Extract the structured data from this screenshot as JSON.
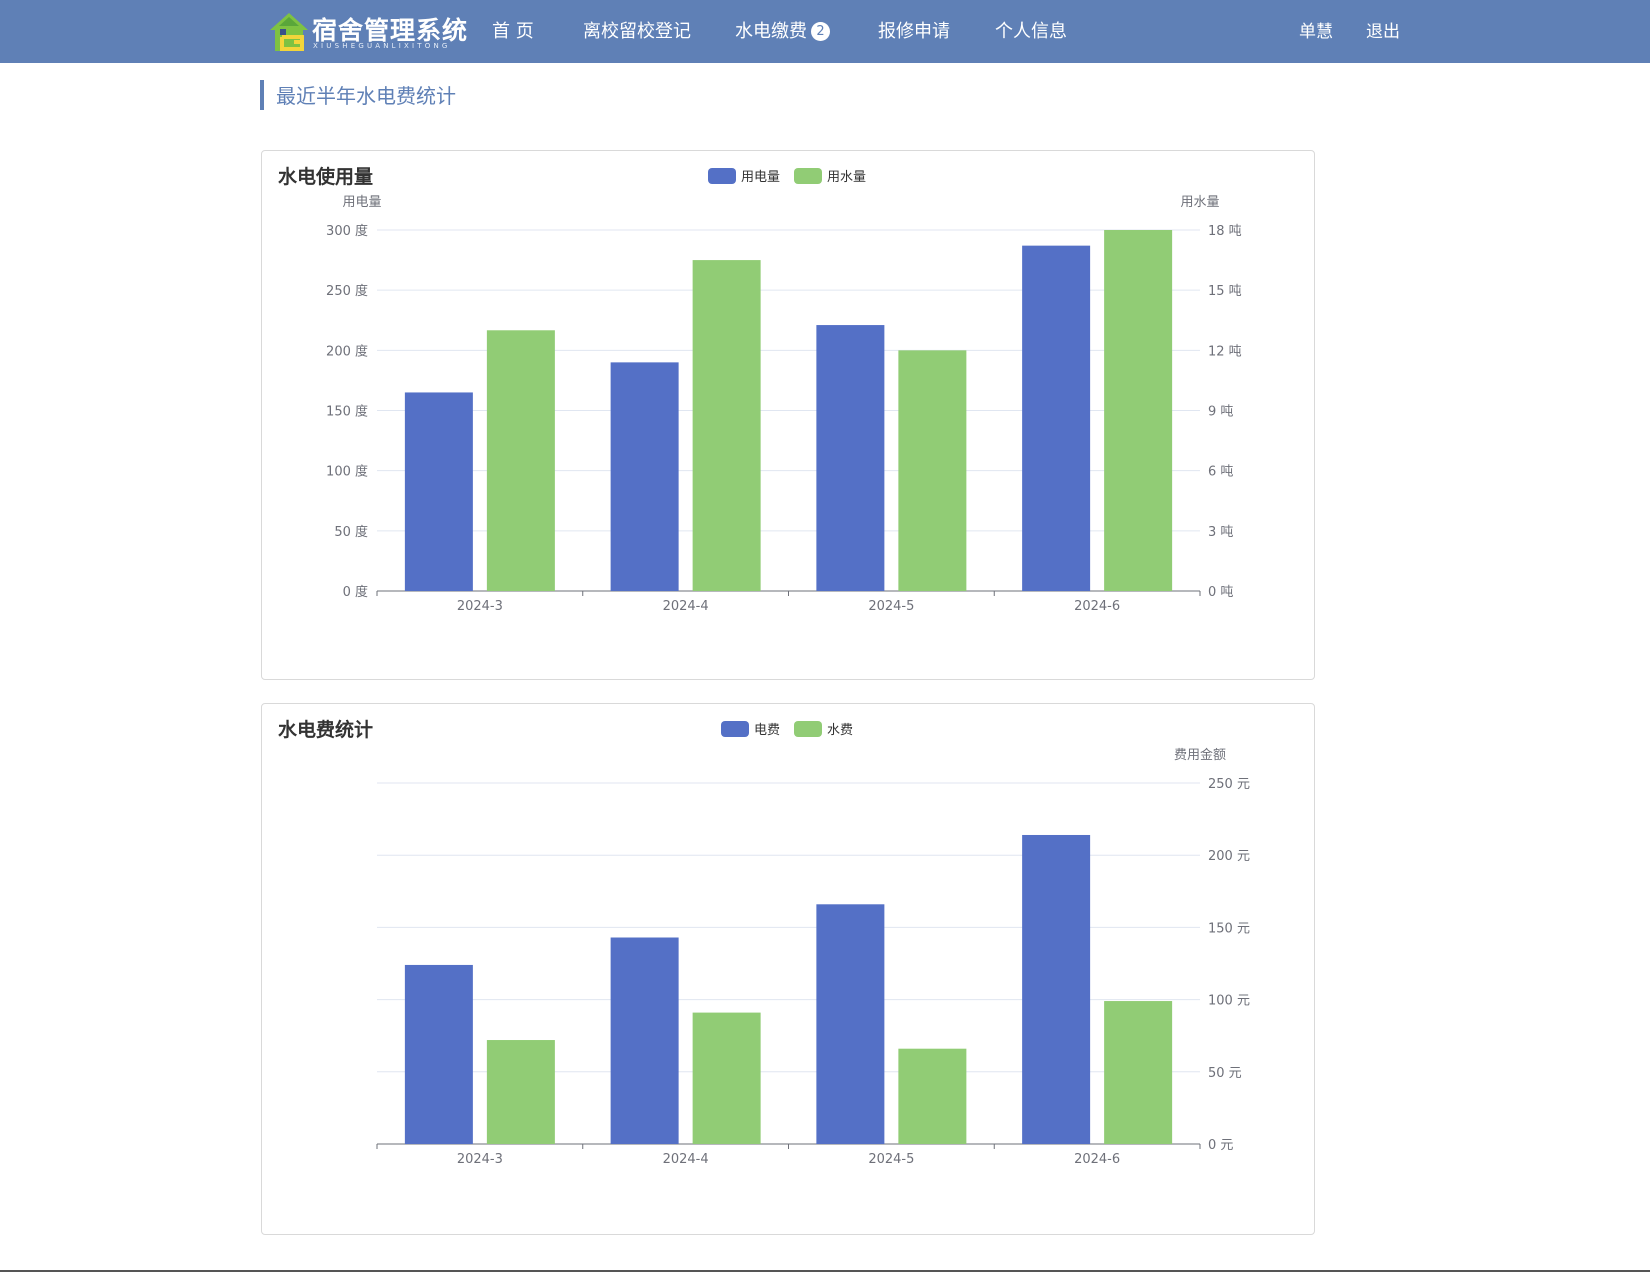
{
  "navbar": {
    "logo": {
      "title": "宿舍管理系统",
      "subtitle": "XIUSHEGUANLIXITONG",
      "icon": "house-logo-icon"
    },
    "items": [
      {
        "label": "首 页"
      },
      {
        "label": "离校留校登记"
      },
      {
        "label": "水电缴费",
        "badge": "2"
      },
      {
        "label": "报修申请"
      },
      {
        "label": "个人信息"
      }
    ],
    "user": "单慧",
    "logout": "退出"
  },
  "page": {
    "heading": "最近半年水电费统计"
  },
  "colors": {
    "nav": "#5f80b6",
    "blue": "#5470c6",
    "green": "#91cc75"
  },
  "chart_data": [
    {
      "type": "bar",
      "title": "水电使用量",
      "categories": [
        "2024-3",
        "2024-4",
        "2024-5",
        "2024-6"
      ],
      "series": [
        {
          "name": "用电量",
          "axis": "left",
          "values": [
            165,
            190,
            221,
            287
          ]
        },
        {
          "name": "用水量",
          "axis": "right",
          "values": [
            13,
            16.5,
            12,
            18
          ]
        }
      ],
      "y_axes": [
        {
          "position": "left",
          "label": "用电量",
          "unit": "度",
          "range": [
            0,
            300
          ],
          "ticks": [
            0,
            50,
            100,
            150,
            200,
            250,
            300
          ]
        },
        {
          "position": "right",
          "label": "用水量",
          "unit": "吨",
          "range": [
            0,
            18
          ],
          "ticks": [
            0,
            3,
            6,
            9,
            12,
            15,
            18
          ]
        }
      ],
      "legend_position": "top-center",
      "grid": true
    },
    {
      "type": "bar",
      "title": "水电费统计",
      "categories": [
        "2024-3",
        "2024-4",
        "2024-5",
        "2024-6"
      ],
      "series": [
        {
          "name": "电费",
          "axis": "right",
          "values": [
            124,
            143,
            166,
            214
          ]
        },
        {
          "name": "水费",
          "axis": "right",
          "values": [
            72,
            91,
            66,
            99
          ]
        }
      ],
      "y_axes": [
        {
          "position": "right",
          "label": "费用金额",
          "unit": "元",
          "range": [
            0,
            250
          ],
          "ticks": [
            0,
            50,
            100,
            150,
            200,
            250
          ]
        }
      ],
      "legend_position": "top-center",
      "grid": true
    }
  ]
}
